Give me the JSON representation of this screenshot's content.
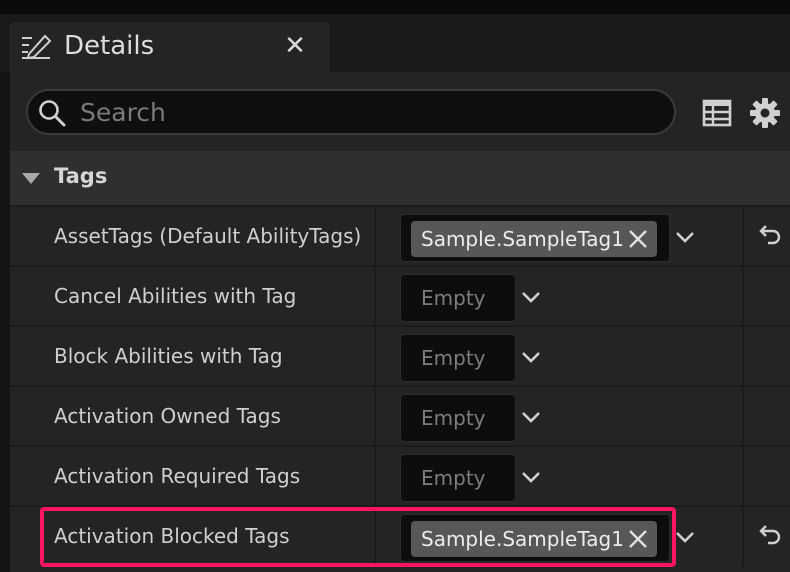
{
  "tab": {
    "title": "Details"
  },
  "search": {
    "placeholder": "Search"
  },
  "category": {
    "label": "Tags"
  },
  "rows": [
    {
      "label": "AssetTags (Default AbilityTags)",
      "value_type": "tag",
      "tag": "Sample.SampleTag1"
    },
    {
      "label": "Cancel Abilities with Tag",
      "value_type": "empty",
      "empty_text": "Empty"
    },
    {
      "label": "Block Abilities with Tag",
      "value_type": "empty",
      "empty_text": "Empty"
    },
    {
      "label": "Activation Owned Tags",
      "value_type": "empty",
      "empty_text": "Empty"
    },
    {
      "label": "Activation Required Tags",
      "value_type": "empty",
      "empty_text": "Empty"
    },
    {
      "label": "Activation Blocked Tags",
      "value_type": "tag",
      "tag": "Sample.SampleTag1"
    }
  ],
  "icons": {
    "tab": "details-pencil-icon",
    "close": "close-icon",
    "search": "search-icon",
    "view": "table-view-icon",
    "settings": "gear-icon",
    "collapse": "triangle-down-icon",
    "dropdown": "chevron-down-icon",
    "remove_tag": "remove-x-icon",
    "reset": "reset-to-default-icon"
  },
  "colors": {
    "highlight": "#ff1464",
    "panel": "#242424",
    "category": "#2f2f2f",
    "tag_pill": "#575757"
  }
}
